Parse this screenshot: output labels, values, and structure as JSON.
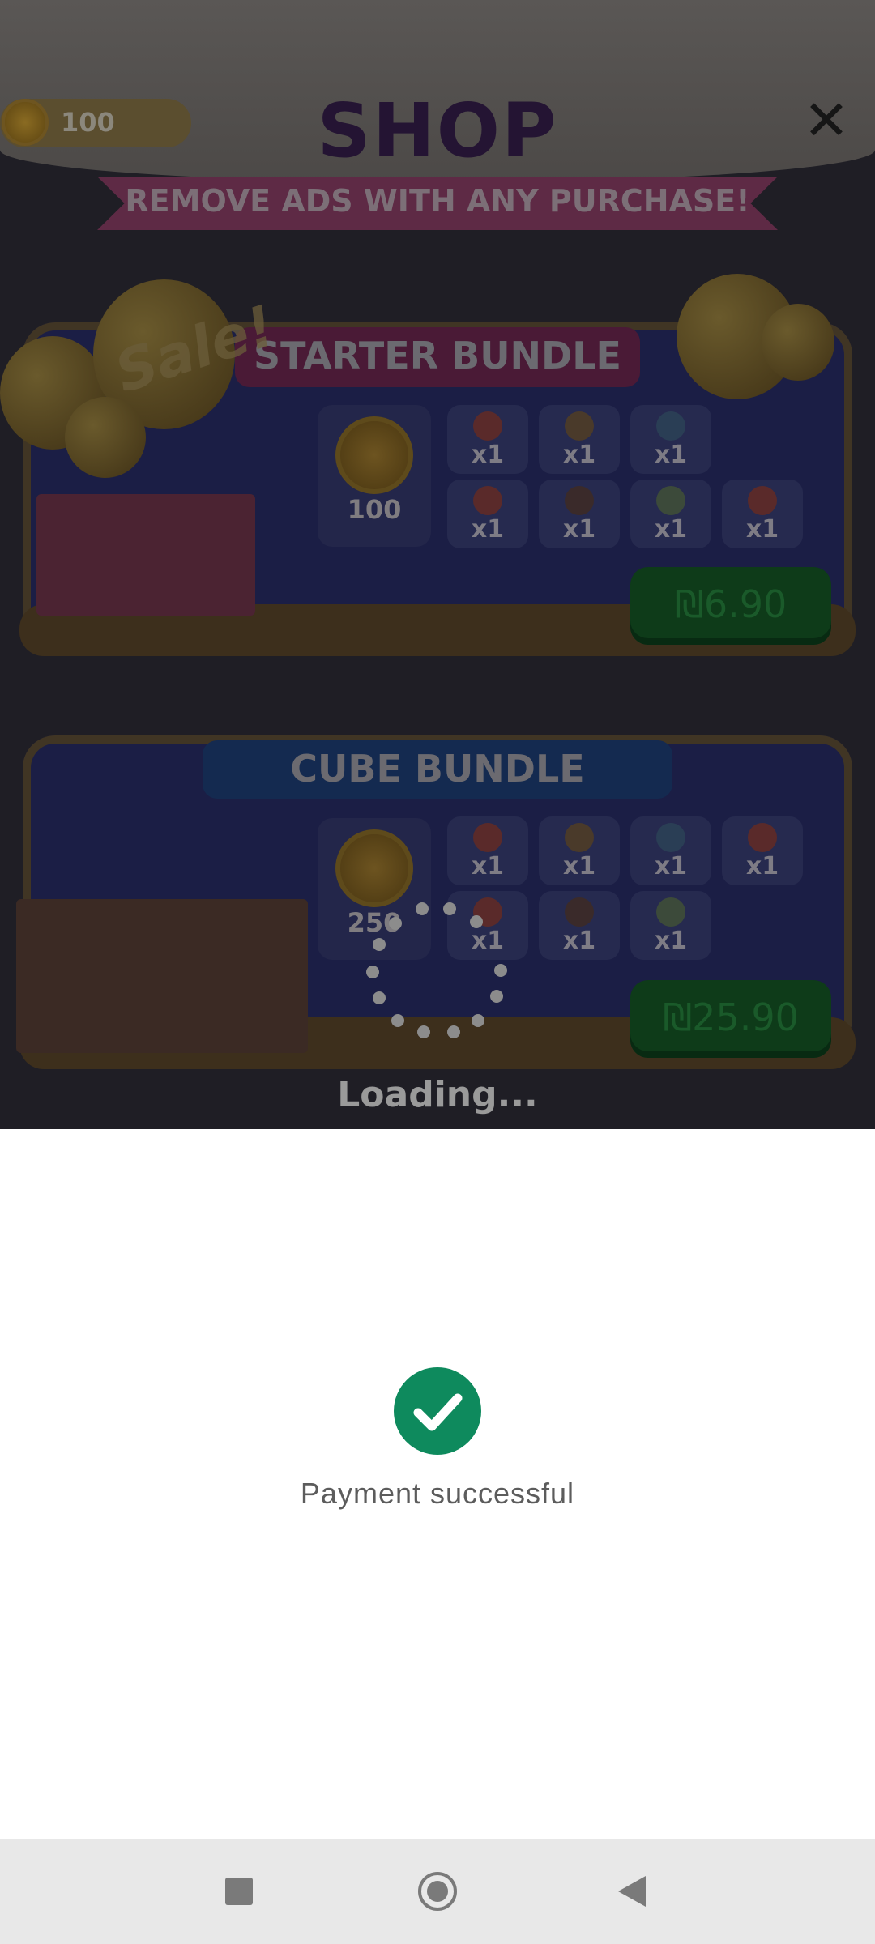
{
  "game": {
    "coin_count": "100",
    "title": "SHOP",
    "close_icon": "close-icon",
    "banner": "REMOVE ADS WITH ANY PURCHASE!",
    "sale_tag": "Sale!",
    "loading": "Loading...",
    "bundles": [
      {
        "title": "STARTER BUNDLE",
        "coins": "100",
        "items": [
          "x1",
          "x1",
          "x1",
          "x1",
          "x1",
          "x1",
          "x1"
        ],
        "price": "₪6.90"
      },
      {
        "title": "CUBE BUNDLE",
        "coins": "250",
        "items": [
          "x1",
          "x1",
          "x1",
          "x1",
          "x1",
          "x1",
          "x1"
        ],
        "price": "₪25.90"
      }
    ]
  },
  "payment": {
    "status": "Payment successful",
    "accent": "#0e8a5d"
  },
  "navbar": {
    "recents": "recents-icon",
    "home": "home-icon",
    "back": "back-icon"
  }
}
